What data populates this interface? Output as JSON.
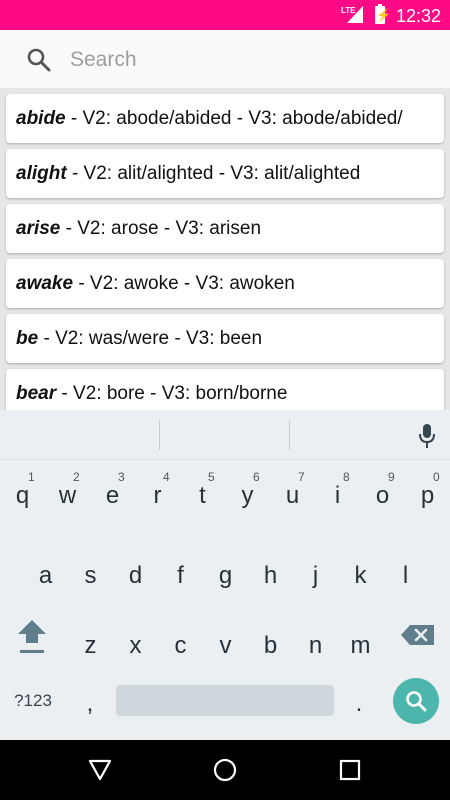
{
  "status_bar": {
    "network": "LTE",
    "time": "12:32",
    "color": "#ff0a86"
  },
  "search": {
    "placeholder": "Search",
    "value": ""
  },
  "verbs": [
    {
      "base": "abide",
      "rest": " - V2: abode/abided - V3: abode/abided/"
    },
    {
      "base": "alight",
      "rest": " - V2: alit/alighted - V3: alit/alighted"
    },
    {
      "base": "arise",
      "rest": " - V2: arose - V3: arisen"
    },
    {
      "base": "awake",
      "rest": " - V2: awoke - V3: awoken"
    },
    {
      "base": "be",
      "rest": " - V2: was/were - V3: been"
    },
    {
      "base": "bear",
      "rest": " - V2: bore - V3: born/borne"
    }
  ],
  "keyboard": {
    "row1": [
      {
        "key": "q",
        "num": "1"
      },
      {
        "key": "w",
        "num": "2"
      },
      {
        "key": "e",
        "num": "3"
      },
      {
        "key": "r",
        "num": "4"
      },
      {
        "key": "t",
        "num": "5"
      },
      {
        "key": "y",
        "num": "6"
      },
      {
        "key": "u",
        "num": "7"
      },
      {
        "key": "i",
        "num": "8"
      },
      {
        "key": "o",
        "num": "9"
      },
      {
        "key": "p",
        "num": "0"
      }
    ],
    "row2": [
      "a",
      "s",
      "d",
      "f",
      "g",
      "h",
      "j",
      "k",
      "l"
    ],
    "row3": [
      "z",
      "x",
      "c",
      "v",
      "b",
      "n",
      "m"
    ],
    "symbols_label": "?123",
    "comma": ",",
    "period": ".",
    "accent_color": "#4db6ac"
  },
  "icons": {
    "search": "search-icon",
    "mic": "microphone-icon",
    "shift": "shift-icon",
    "delete": "backspace-icon",
    "back": "back-triangle-icon",
    "home": "home-circle-icon",
    "recent": "recent-apps-icon"
  }
}
